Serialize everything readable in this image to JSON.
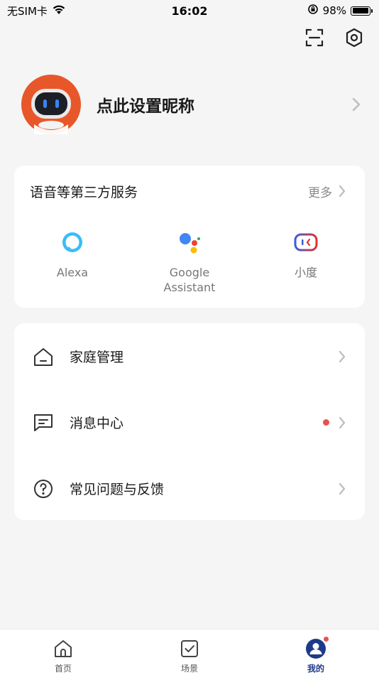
{
  "status_bar": {
    "carrier": "无SIM卡",
    "time": "16:02",
    "battery_percent": "98%",
    "battery_level": 0.98
  },
  "profile": {
    "nickname": "点此设置昵称"
  },
  "voice_services": {
    "title": "语音等第三方服务",
    "more_label": "更多",
    "items": [
      {
        "label": "Alexa",
        "icon": "alexa-icon"
      },
      {
        "label": "Google Assistant",
        "icon": "google-assistant-icon"
      },
      {
        "label": "小度",
        "icon": "xiaodu-icon"
      }
    ]
  },
  "menu": {
    "items": [
      {
        "label": "家庭管理",
        "icon": "home-icon",
        "has_dot": false
      },
      {
        "label": "消息中心",
        "icon": "message-icon",
        "has_dot": true
      },
      {
        "label": "常见问题与反馈",
        "icon": "help-icon",
        "has_dot": false
      }
    ]
  },
  "tab_bar": {
    "tabs": [
      {
        "label": "首页",
        "icon": "home-tab-icon",
        "active": false
      },
      {
        "label": "场景",
        "icon": "scene-tab-icon",
        "active": false
      },
      {
        "label": "我的",
        "icon": "profile-tab-icon",
        "active": true
      }
    ]
  },
  "colors": {
    "accent": "#1e3a8a",
    "badge": "#e5534b",
    "background": "#f5f5f5",
    "avatar_orange": "#e8572a"
  }
}
